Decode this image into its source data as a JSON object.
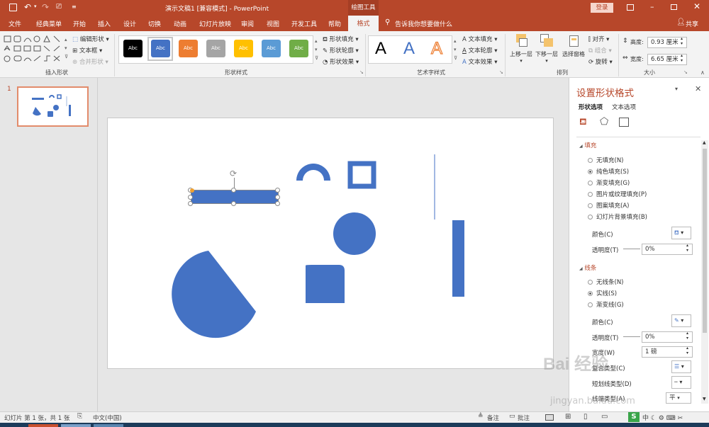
{
  "titlebar": {
    "title": "演示文稿1 [兼容模式] - PowerPoint",
    "context_tab": "绘图工具",
    "login": "登录"
  },
  "tabs": [
    "文件",
    "经典菜单",
    "开始",
    "插入",
    "设计",
    "切换",
    "动画",
    "幻灯片放映",
    "审阅",
    "视图",
    "开发工具",
    "帮助",
    "格式"
  ],
  "tell_me": "告诉我你想要做什么",
  "share": "共享",
  "ribbon": {
    "insert_shapes": {
      "label": "插入形状",
      "edit_shape": "编辑形状",
      "text_box": "文本框",
      "merge_shapes": "合并形状"
    },
    "shape_styles": {
      "label": "形状样式",
      "swatch_text": "Abc",
      "fill": "形状填充",
      "outline": "形状轮廓",
      "effects": "形状效果",
      "swatches": [
        "#000000",
        "#4472c4",
        "#ed7d31",
        "#a5a5a5",
        "#ffc000",
        "#5b9bd5",
        "#70ad47"
      ]
    },
    "wordart": {
      "label": "艺术字样式",
      "letter": "A",
      "text_fill": "文本填充",
      "text_outline": "文本轮廓",
      "text_effects": "文本效果"
    },
    "arrange": {
      "label": "排列",
      "bring_forward": "上移一层",
      "send_backward": "下移一层",
      "selection_pane": "选择窗格",
      "align": "对齐",
      "group": "组合",
      "rotate": "旋转"
    },
    "size": {
      "label": "大小",
      "height_label": "高度:",
      "height": "0.93 厘米",
      "width_label": "宽度:",
      "width": "6.65 厘米"
    }
  },
  "thumbnail": {
    "number": "1"
  },
  "pane": {
    "title": "设置形状格式",
    "tab_shape": "形状选项",
    "tab_text": "文本选项",
    "fill": {
      "header": "填充",
      "options": [
        "无填充(N)",
        "纯色填充(S)",
        "渐变填充(G)",
        "图片或纹理填充(P)",
        "图案填充(A)",
        "幻灯片背景填充(B)"
      ],
      "selected": 1,
      "color_label": "颜色(C)",
      "transparency_label": "透明度(T)",
      "transparency": "0%"
    },
    "line": {
      "header": "线条",
      "options": [
        "无线条(N)",
        "实线(S)",
        "渐变线(G)"
      ],
      "selected": 1,
      "color_label": "颜色(C)",
      "transparency_label": "透明度(T)",
      "transparency": "0%",
      "width_label": "宽度(W)",
      "width": "1 磅",
      "compound_label": "复合类型(C)",
      "dash_label": "短划线类型(D)",
      "cap_label": "线端类型(A)",
      "cap_value": "平"
    }
  },
  "statusbar": {
    "slide_info": "幻灯片 第 1 张，共 1 张",
    "language": "中文(中国)",
    "notes": "备注",
    "comments": "批注"
  },
  "watermark": {
    "text": "Bai 经验",
    "url": "jingyan.baidu.com"
  },
  "colors": {
    "accent": "#b7472a",
    "shape": "#4472c4"
  }
}
